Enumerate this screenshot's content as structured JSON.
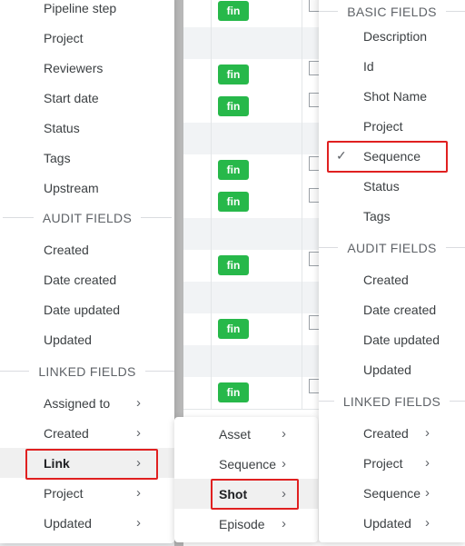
{
  "table": {
    "rows": [
      {
        "group": false,
        "badge": "fin"
      },
      {
        "group": true,
        "badge": ""
      },
      {
        "group": false,
        "badge": "fin"
      },
      {
        "group": false,
        "badge": "fin"
      },
      {
        "group": true,
        "badge": ""
      },
      {
        "group": false,
        "badge": "fin"
      },
      {
        "group": false,
        "badge": "fin"
      },
      {
        "group": true,
        "badge": ""
      },
      {
        "group": false,
        "badge": "fin"
      },
      {
        "group": true,
        "badge": ""
      },
      {
        "group": false,
        "badge": "fin"
      },
      {
        "group": true,
        "badge": ""
      },
      {
        "group": false,
        "badge": "fin"
      }
    ],
    "badge_color": "#27b84a"
  },
  "left_menu": {
    "top_items": [
      "Pipeline step",
      "Project",
      "Reviewers",
      "Start date",
      "Status",
      "Tags",
      "Upstream"
    ],
    "audit_header": "AUDIT FIELDS",
    "audit_items": [
      "Created",
      "Date created",
      "Date updated",
      "Updated"
    ],
    "linked_header": "LINKED FIELDS",
    "linked_items": [
      "Assigned to",
      "Created",
      "Link",
      "Project",
      "Updated"
    ]
  },
  "middle_menu": {
    "items": [
      "Asset",
      "Sequence",
      "Shot",
      "Episode"
    ]
  },
  "right_menu": {
    "basic_header": "BASIC FIELDS",
    "basic_items": [
      "Description",
      "Id",
      "Shot Name",
      "Project",
      "Sequence",
      "Status",
      "Tags"
    ],
    "audit_header": "AUDIT FIELDS",
    "audit_items": [
      "Created",
      "Date created",
      "Date updated",
      "Updated"
    ],
    "linked_header": "LINKED FIELDS",
    "linked_items": [
      "Created",
      "Project",
      "Sequence",
      "Updated"
    ]
  },
  "icons": {
    "chevron": "chevron-right-icon",
    "check": "checkmark-icon"
  },
  "highlight_color": "#e02020"
}
